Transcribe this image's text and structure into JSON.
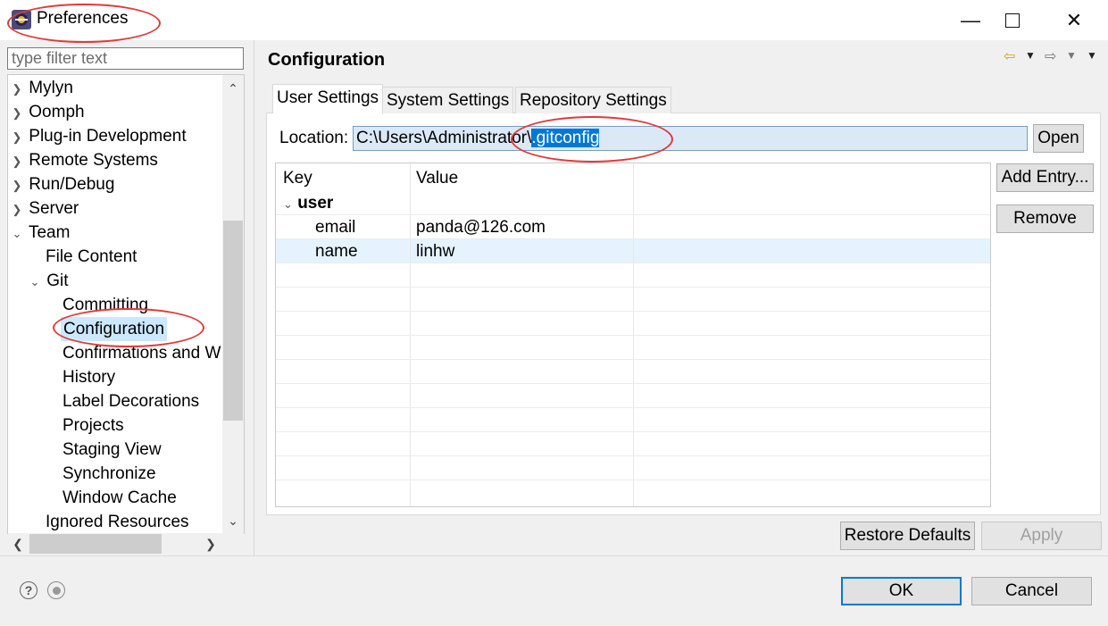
{
  "window": {
    "title": "Preferences",
    "app_icon": "eclipse-icon",
    "controls": {
      "minimize": "minimize-icon",
      "maximize": "maximize-icon",
      "close": "close-icon"
    }
  },
  "filter": {
    "placeholder": "type filter text",
    "value": ""
  },
  "tree": {
    "items": [
      {
        "label": "Mylyn",
        "level": 0,
        "state": "collapsed"
      },
      {
        "label": "Oomph",
        "level": 0,
        "state": "collapsed"
      },
      {
        "label": "Plug-in Development",
        "level": 0,
        "state": "collapsed"
      },
      {
        "label": "Remote Systems",
        "level": 0,
        "state": "collapsed"
      },
      {
        "label": "Run/Debug",
        "level": 0,
        "state": "collapsed"
      },
      {
        "label": "Server",
        "level": 0,
        "state": "collapsed"
      },
      {
        "label": "Team",
        "level": 0,
        "state": "expanded"
      },
      {
        "label": "File Content",
        "level": 1,
        "state": "leaf"
      },
      {
        "label": "Git",
        "level": 1,
        "state": "expanded"
      },
      {
        "label": "Committing",
        "level": 2,
        "state": "leaf"
      },
      {
        "label": "Configuration",
        "level": 2,
        "state": "leaf",
        "selected": true
      },
      {
        "label": "Confirmations and W",
        "level": 2,
        "state": "leaf"
      },
      {
        "label": "History",
        "level": 2,
        "state": "leaf"
      },
      {
        "label": "Label Decorations",
        "level": 2,
        "state": "leaf"
      },
      {
        "label": "Projects",
        "level": 2,
        "state": "leaf"
      },
      {
        "label": "Staging View",
        "level": 2,
        "state": "leaf"
      },
      {
        "label": "Synchronize",
        "level": 2,
        "state": "leaf"
      },
      {
        "label": "Window Cache",
        "level": 2,
        "state": "leaf"
      },
      {
        "label": "Ignored Resources",
        "level": 1,
        "state": "leaf"
      }
    ]
  },
  "page": {
    "title": "Configuration",
    "tabs": [
      {
        "label": "User Settings",
        "active": true
      },
      {
        "label": "System Settings",
        "active": false
      },
      {
        "label": "Repository Settings",
        "active": false
      }
    ],
    "location": {
      "label": "Location:",
      "value_prefix": "C:\\Users\\Administrator\\",
      "value_selected": ".gitconfig"
    },
    "open_button": "Open",
    "table": {
      "columns": [
        "Key",
        "Value"
      ],
      "section": "user",
      "rows": [
        {
          "key": "email",
          "value": "panda@126.com"
        },
        {
          "key": "name",
          "value": "linhw"
        }
      ]
    },
    "add_entry_button": "Add Entry...",
    "remove_button": "Remove",
    "restore_defaults_button": "Restore Defaults",
    "apply_button": "Apply"
  },
  "footer": {
    "help_icon": "help-icon",
    "import_export_icon": "record-icon",
    "ok_button": "OK",
    "cancel_button": "Cancel"
  },
  "colors": {
    "selection": "#0078d7",
    "annotation": "#e03a3a",
    "tree_selected": "#cce8ff"
  }
}
